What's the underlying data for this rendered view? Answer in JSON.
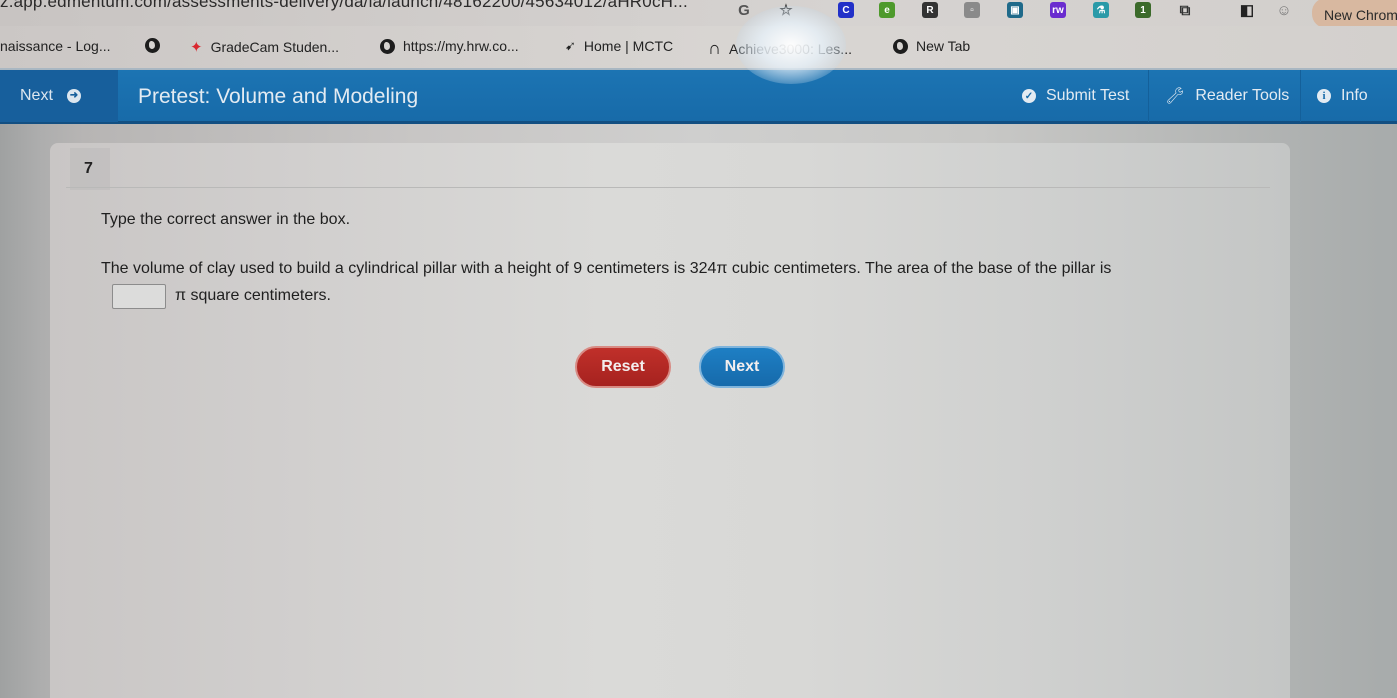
{
  "browser": {
    "url": "z.app.edmentum.com/assessments-delivery/da/la/launch/48162200/45634012/aHR0cH...",
    "new_chrome_label": "New Chrome",
    "extensions": [
      {
        "name": "translate-icon",
        "glyph": "G",
        "color": "#555555"
      },
      {
        "name": "bookmark-star-icon",
        "glyph": "☆",
        "color": "#333333"
      },
      {
        "name": "extension-c-icon",
        "glyph": "C",
        "color": "#2230c8"
      },
      {
        "name": "extension-green-icon",
        "glyph": "e",
        "color": "#4e9a2c"
      },
      {
        "name": "extension-r-icon",
        "glyph": "R",
        "color": "#333333"
      },
      {
        "name": "extension-doc-icon",
        "glyph": "▫",
        "color": "#8a8a8a"
      },
      {
        "name": "extension-game-icon",
        "glyph": "▣",
        "color": "#1f6a8a"
      },
      {
        "name": "extension-rw-icon",
        "glyph": "rw",
        "color": "#6a2ccf"
      },
      {
        "name": "extension-flask-icon",
        "glyph": "⚗",
        "color": "#2a9aa8"
      },
      {
        "name": "extension-badge-icon",
        "glyph": "1",
        "color": "#3b6a2a"
      },
      {
        "name": "extensions-puzzle-icon",
        "glyph": "⧉",
        "color": "#333333"
      },
      {
        "name": "side-panel-icon",
        "glyph": "◧",
        "color": "#222222"
      },
      {
        "name": "profile-avatar-icon",
        "glyph": "☺",
        "color": "#777777"
      }
    ],
    "bookmarks": [
      {
        "label": "naissance - Log...",
        "icon": "none"
      },
      {
        "label": "",
        "icon": "globe-icon"
      },
      {
        "label": "GradeCam Studen...",
        "icon": "gradecam-icon"
      },
      {
        "label": "https://my.hrw.co...",
        "icon": "globe-icon"
      },
      {
        "label": "Home | MCTC",
        "icon": "mctc-icon"
      },
      {
        "label": "Achieve3000: Les...",
        "icon": "achieve-icon"
      },
      {
        "label": "New Tab",
        "icon": "globe-icon"
      }
    ]
  },
  "header": {
    "next_label": "Next",
    "title": "Pretest: Volume and Modeling",
    "submit_label": "Submit Test",
    "reader_tools_label": "Reader Tools",
    "info_label": "Info",
    "accent_color": "#1a70b0"
  },
  "question": {
    "number": "7",
    "instruction": "Type the correct answer in the box.",
    "text": "The volume of clay used to build a cylindrical pillar with a height of 9 centimeters is 324π cubic centimeters. The area of the base of the pillar is",
    "answer_value": "",
    "answer_placeholder": "",
    "after_input": "π square centimeters."
  },
  "actions": {
    "reset_label": "Reset",
    "next_label": "Next",
    "reset_color": "#b2271f",
    "next_color": "#1a74b8"
  }
}
